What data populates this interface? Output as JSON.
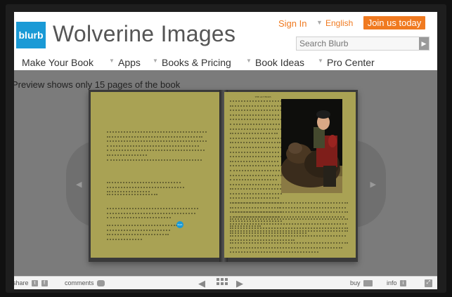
{
  "header": {
    "logo_text": "blurb",
    "site_title": "Wolverine Images",
    "sign_in": "Sign In",
    "language": "English",
    "join_button": "Join us today",
    "search_placeholder": "Search Blurb"
  },
  "nav": {
    "items": [
      {
        "label": "Make Your Book"
      },
      {
        "label": "Apps"
      },
      {
        "label": "Books & Pricing"
      },
      {
        "label": "Book Ideas"
      },
      {
        "label": "Pro Center"
      }
    ]
  },
  "preview": {
    "note": "Preview shows only 15 pages of the book"
  },
  "book": {
    "right_heading": "THE AUTHORS",
    "badge_text": "blurb"
  },
  "toolbar": {
    "share": "share",
    "comments": "comments",
    "buy": "buy",
    "info": "info"
  },
  "colors": {
    "brand_blue": "#1a9ad6",
    "accent_orange": "#f07a20",
    "page_olive": "#a9a254"
  }
}
